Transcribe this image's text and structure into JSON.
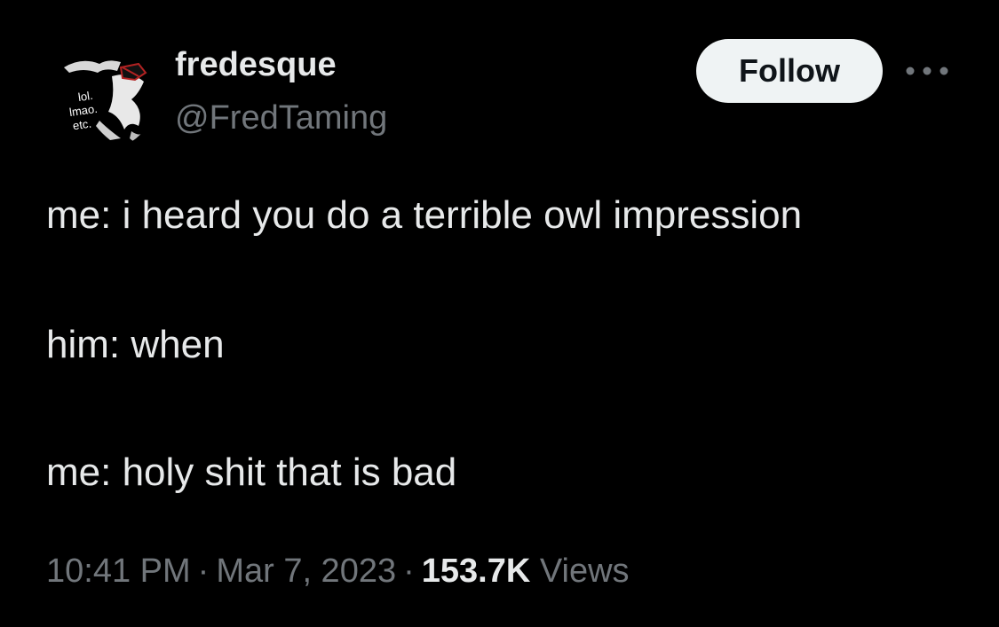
{
  "user": {
    "display_name": "fredesque",
    "handle": "@FredTaming",
    "avatar_text": [
      "lol.",
      "lmao.",
      "etc."
    ]
  },
  "actions": {
    "follow_label": "Follow",
    "more_icon": "more-horizontal-icon"
  },
  "tweet": {
    "lines": [
      "me: i heard you do a terrible owl impression",
      "him: when",
      "me: holy shit that is bad"
    ]
  },
  "meta": {
    "time": "10:41 PM",
    "date": "Mar 7, 2023",
    "separator": "·",
    "views_count": "153.7K",
    "views_label": "Views"
  },
  "colors": {
    "background": "#000000",
    "primary_text": "#e7e9ea",
    "secondary_text": "#71767b",
    "follow_bg": "#eff3f4",
    "follow_text": "#0f1419"
  }
}
